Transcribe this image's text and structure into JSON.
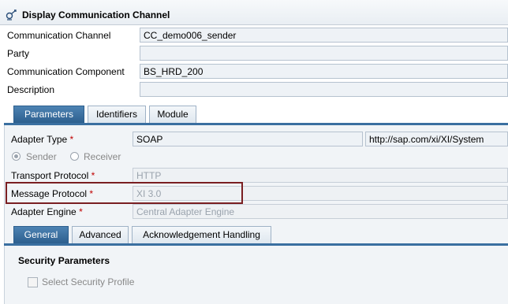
{
  "window": {
    "title": "Display Communication Channel"
  },
  "header": {
    "rows": [
      {
        "label": "Communication Channel",
        "value": "CC_demo006_sender"
      },
      {
        "label": "Party",
        "value": ""
      },
      {
        "label": "Communication Component",
        "value": "BS_HRD_200"
      },
      {
        "label": "Description",
        "value": ""
      }
    ]
  },
  "main_tabs": [
    {
      "label": "Parameters",
      "active": true
    },
    {
      "label": "Identifiers",
      "active": false
    },
    {
      "label": "Module",
      "active": false
    }
  ],
  "parameters": {
    "adapter_type": {
      "label": "Adapter Type",
      "required_mark": "*",
      "value": "SOAP",
      "namespace": "http://sap.com/xi/XI/System"
    },
    "direction": {
      "sender_label": "Sender",
      "receiver_label": "Receiver",
      "selected": "Sender"
    },
    "transport_protocol": {
      "label": "Transport Protocol",
      "required_mark": "*",
      "value": "HTTP"
    },
    "message_protocol": {
      "label": "Message Protocol",
      "required_mark": "*",
      "value": "XI 3.0"
    },
    "adapter_engine": {
      "label": "Adapter Engine",
      "required_mark": "*",
      "value": "Central Adapter Engine"
    }
  },
  "sub_tabs": [
    {
      "label": "General",
      "active": true
    },
    {
      "label": "Advanced",
      "active": false
    },
    {
      "label": "Acknowledgement Handling",
      "active": false
    }
  ],
  "security": {
    "heading": "Security Parameters",
    "select_profile_label": "Select Security Profile",
    "select_profile_checked": false
  },
  "colors": {
    "active_tab": "#3a6fa0",
    "highlight_box": "#7a1f22",
    "required": "#c00000"
  }
}
